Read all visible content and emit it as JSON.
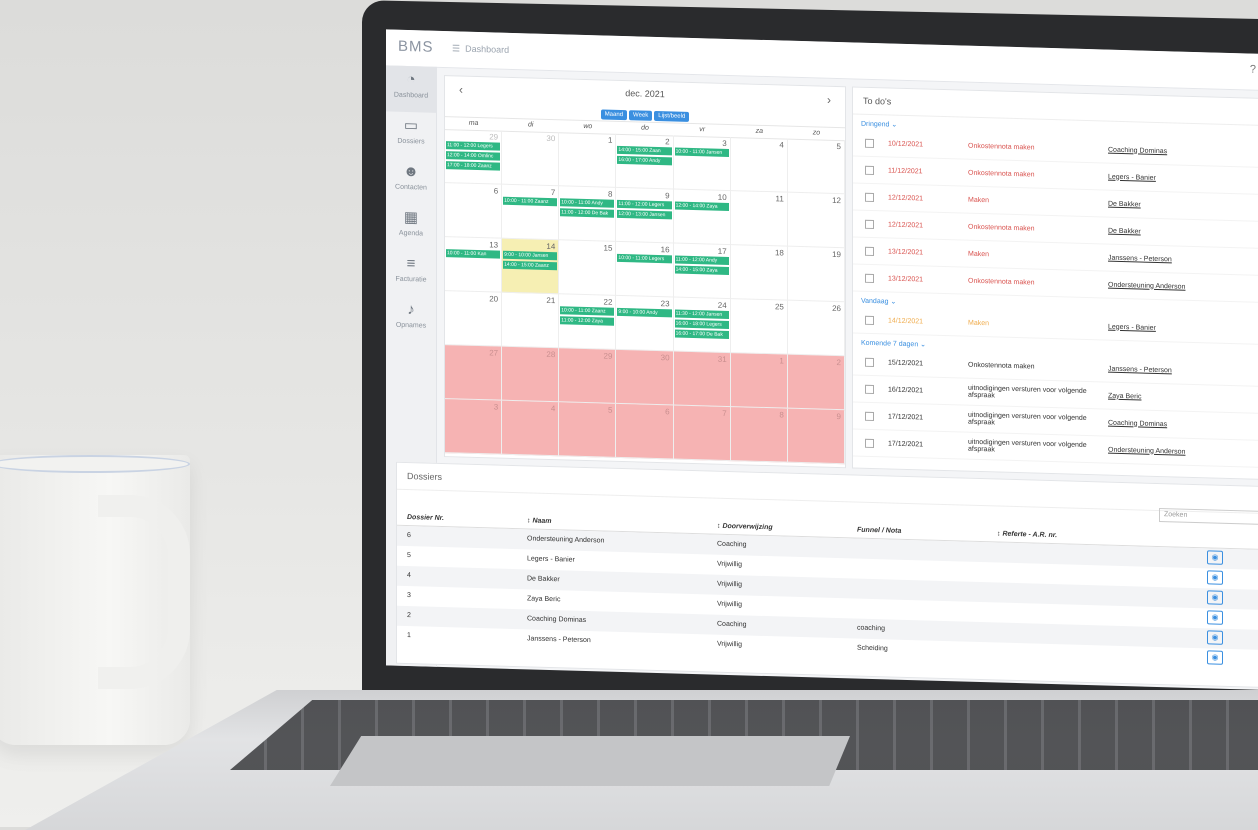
{
  "app": {
    "logo": "BMS",
    "breadcrumb": "Dashboard"
  },
  "sidebar": {
    "items": [
      {
        "label": "Dashboard",
        "icon": "gauge-icon"
      },
      {
        "label": "Dossiers",
        "icon": "folder-icon"
      },
      {
        "label": "Contacten",
        "icon": "users-icon"
      },
      {
        "label": "Agenda",
        "icon": "calendar-icon"
      },
      {
        "label": "Facturatie",
        "icon": "database-icon"
      },
      {
        "label": "Opnames",
        "icon": "microphone-icon"
      }
    ]
  },
  "calendar": {
    "month": "dec. 2021",
    "views": [
      "Maand",
      "Week",
      "Lijst/beeld"
    ],
    "weekdays": [
      "ma",
      "di",
      "wo",
      "do",
      "vr",
      "za",
      "zo"
    ],
    "days": [
      {
        "n": "29",
        "c": "other",
        "ev": [
          "11:00 - 12:00 Legers",
          "12:00 - 14:00 Omlinc",
          "17:00 - 18:00 Zaanz"
        ]
      },
      {
        "n": "30",
        "c": "other",
        "ev": []
      },
      {
        "n": "1",
        "c": "",
        "ev": []
      },
      {
        "n": "2",
        "c": "",
        "ev": [
          "14:00 - 15:00 Zaan",
          "16:00 - 17:00 Andy"
        ]
      },
      {
        "n": "3",
        "c": "",
        "ev": [
          "10:00 - 11:00 Jansen"
        ]
      },
      {
        "n": "4",
        "c": "",
        "ev": []
      },
      {
        "n": "5",
        "c": "",
        "ev": []
      },
      {
        "n": "6",
        "c": "",
        "ev": []
      },
      {
        "n": "7",
        "c": "",
        "ev": [
          "10:00 - 11:00 Zaanz"
        ]
      },
      {
        "n": "8",
        "c": "",
        "ev": [
          "10:00 - 11:00 Andy",
          "11:00 - 12:00 De Bak"
        ]
      },
      {
        "n": "9",
        "c": "",
        "ev": [
          "11:00 - 12:00 Legers",
          "12:00 - 13:00 Jansen"
        ]
      },
      {
        "n": "10",
        "c": "",
        "ev": [
          "12:00 - 14:00 Zaya"
        ]
      },
      {
        "n": "11",
        "c": "",
        "ev": []
      },
      {
        "n": "12",
        "c": "",
        "ev": []
      },
      {
        "n": "13",
        "c": "",
        "ev": [
          "10:00 - 11:00 Kan"
        ]
      },
      {
        "n": "14",
        "c": "today",
        "ev": [
          "9:00 - 10:00 Jansen",
          "14:00 - 15:00 Zaanz"
        ]
      },
      {
        "n": "15",
        "c": "",
        "ev": []
      },
      {
        "n": "16",
        "c": "",
        "ev": [
          "10:00 - 11:00 Legers"
        ]
      },
      {
        "n": "17",
        "c": "",
        "ev": [
          "11:00 - 12:00 Andy",
          "14:00 - 15:00 Zaya"
        ]
      },
      {
        "n": "18",
        "c": "",
        "ev": []
      },
      {
        "n": "19",
        "c": "",
        "ev": []
      },
      {
        "n": "20",
        "c": "",
        "ev": []
      },
      {
        "n": "21",
        "c": "",
        "ev": []
      },
      {
        "n": "22",
        "c": "",
        "ev": [
          "10:00 - 11:00 Zaanz",
          "11:00 - 12:00 Zaya"
        ]
      },
      {
        "n": "23",
        "c": "",
        "ev": [
          "9:00 - 10:00 Andy"
        ]
      },
      {
        "n": "24",
        "c": "",
        "ev": [
          "11:30 - 12:00 Jansen",
          "16:00 - 18:00 Legers",
          "16:00 - 17:00 De Bak"
        ]
      },
      {
        "n": "25",
        "c": "",
        "ev": []
      },
      {
        "n": "26",
        "c": "",
        "ev": []
      },
      {
        "n": "27",
        "c": "blocked",
        "ev": []
      },
      {
        "n": "28",
        "c": "blocked",
        "ev": []
      },
      {
        "n": "29",
        "c": "blocked",
        "ev": []
      },
      {
        "n": "30",
        "c": "blocked",
        "ev": []
      },
      {
        "n": "31",
        "c": "blocked",
        "ev": []
      },
      {
        "n": "1",
        "c": "blocked",
        "ev": []
      },
      {
        "n": "2",
        "c": "blocked",
        "ev": []
      },
      {
        "n": "3",
        "c": "blocked",
        "ev": []
      },
      {
        "n": "4",
        "c": "blocked",
        "ev": []
      },
      {
        "n": "5",
        "c": "blocked",
        "ev": []
      },
      {
        "n": "6",
        "c": "blocked",
        "ev": []
      },
      {
        "n": "7",
        "c": "blocked",
        "ev": []
      },
      {
        "n": "8",
        "c": "blocked",
        "ev": []
      },
      {
        "n": "9",
        "c": "blocked",
        "ev": []
      }
    ]
  },
  "todos": {
    "title": "To do's",
    "groups": [
      {
        "label": "Dringend ⌄",
        "cls": "red",
        "rows": [
          {
            "date": "10/12/2021",
            "task": "Onkostennota maken",
            "link": "Coaching Dominas"
          },
          {
            "date": "11/12/2021",
            "task": "Onkostennota maken",
            "link": "Legers - Banier"
          },
          {
            "date": "12/12/2021",
            "task": "Maken",
            "link": "De Bakker"
          },
          {
            "date": "12/12/2021",
            "task": "Onkostennota maken",
            "link": "De Bakker"
          },
          {
            "date": "13/12/2021",
            "task": "Maken",
            "link": "Janssens - Peterson"
          },
          {
            "date": "13/12/2021",
            "task": "Onkostennota maken",
            "link": "Ondersteuning Anderson"
          }
        ]
      },
      {
        "label": "Vandaag ⌄",
        "cls": "orange",
        "rows": [
          {
            "date": "14/12/2021",
            "task": "Maken",
            "link": "Legers - Banier"
          }
        ]
      },
      {
        "label": "Komende 7 dagen ⌄",
        "cls": "",
        "rows": [
          {
            "date": "15/12/2021",
            "task": "Onkostennota maken",
            "link": "Janssens - Peterson"
          },
          {
            "date": "16/12/2021",
            "task": "uitnodigingen versturen voor volgende afspraak",
            "link": "Zaya Beric"
          },
          {
            "date": "17/12/2021",
            "task": "uitnodigingen versturen voor volgende afspraak",
            "link": "Coaching Dominas"
          },
          {
            "date": "17/12/2021",
            "task": "uitnodigingen versturen voor volgende afspraak",
            "link": "Ondersteuning Anderson"
          }
        ]
      }
    ]
  },
  "dossiers": {
    "title": "Dossiers",
    "search_placeholder": "Zoeken",
    "columns": [
      "Dossier Nr.",
      "↕ Naam",
      "↕ Doorverwijzing",
      "Funnel / Nota",
      "↕ Referte - A.R. nr.",
      ""
    ],
    "rows": [
      [
        "6",
        "Ondersteuning Anderson",
        "Coaching",
        ""
      ],
      [
        "5",
        "Legers - Banier",
        "Vrijwillig",
        ""
      ],
      [
        "4",
        "De Bakker",
        "Vrijwillig",
        ""
      ],
      [
        "3",
        "Zaya Beric",
        "Vrijwillig",
        ""
      ],
      [
        "2",
        "Coaching Dominas",
        "Coaching",
        "coaching"
      ],
      [
        "1",
        "Janssens - Peterson",
        "Vrijwillig",
        "Scheiding"
      ]
    ]
  }
}
